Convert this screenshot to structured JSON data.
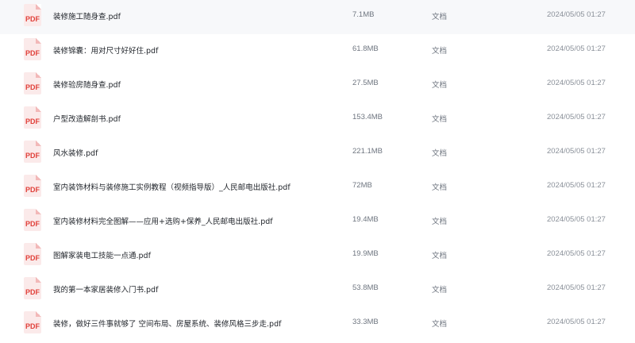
{
  "files": [
    {
      "icon": "pdf-file-icon",
      "badge": "PDF",
      "name": "装修施工随身查.pdf",
      "size": "7.1MB",
      "type": "文档",
      "modified": "2024/05/05 01:27"
    },
    {
      "icon": "pdf-file-icon",
      "badge": "PDF",
      "name": "装修锦囊：用对尺寸好好住.pdf",
      "size": "61.8MB",
      "type": "文档",
      "modified": "2024/05/05 01:27"
    },
    {
      "icon": "pdf-file-icon",
      "badge": "PDF",
      "name": "装修验房随身查.pdf",
      "size": "27.5MB",
      "type": "文档",
      "modified": "2024/05/05 01:27"
    },
    {
      "icon": "pdf-file-icon",
      "badge": "PDF",
      "name": "户型改造解剖书.pdf",
      "size": "153.4MB",
      "type": "文档",
      "modified": "2024/05/05 01:27"
    },
    {
      "icon": "pdf-file-icon",
      "badge": "PDF",
      "name": "风水装修.pdf",
      "size": "221.1MB",
      "type": "文档",
      "modified": "2024/05/05 01:27"
    },
    {
      "icon": "pdf-file-icon",
      "badge": "PDF",
      "name": "室内装饰材料与装修施工实例教程（视频指导版）_人民邮电出版社.pdf",
      "size": "72MB",
      "type": "文档",
      "modified": "2024/05/05 01:27"
    },
    {
      "icon": "pdf-file-icon",
      "badge": "PDF",
      "name": "室内装修材料完全图解——应用+选购+保养_人民邮电出版社.pdf",
      "size": "19.4MB",
      "type": "文档",
      "modified": "2024/05/05 01:27"
    },
    {
      "icon": "pdf-file-icon",
      "badge": "PDF",
      "name": "图解家装电工技能一点通.pdf",
      "size": "19.9MB",
      "type": "文档",
      "modified": "2024/05/05 01:27"
    },
    {
      "icon": "pdf-file-icon",
      "badge": "PDF",
      "name": "我的第一本家居装修入门书.pdf",
      "size": "53.8MB",
      "type": "文档",
      "modified": "2024/05/05 01:27"
    },
    {
      "icon": "pdf-file-icon",
      "badge": "PDF",
      "name": "装修，做好三件事就够了 空间布局、房屋系统、装修风格三步走.pdf",
      "size": "33.3MB",
      "type": "文档",
      "modified": "2024/05/05 01:27"
    }
  ]
}
